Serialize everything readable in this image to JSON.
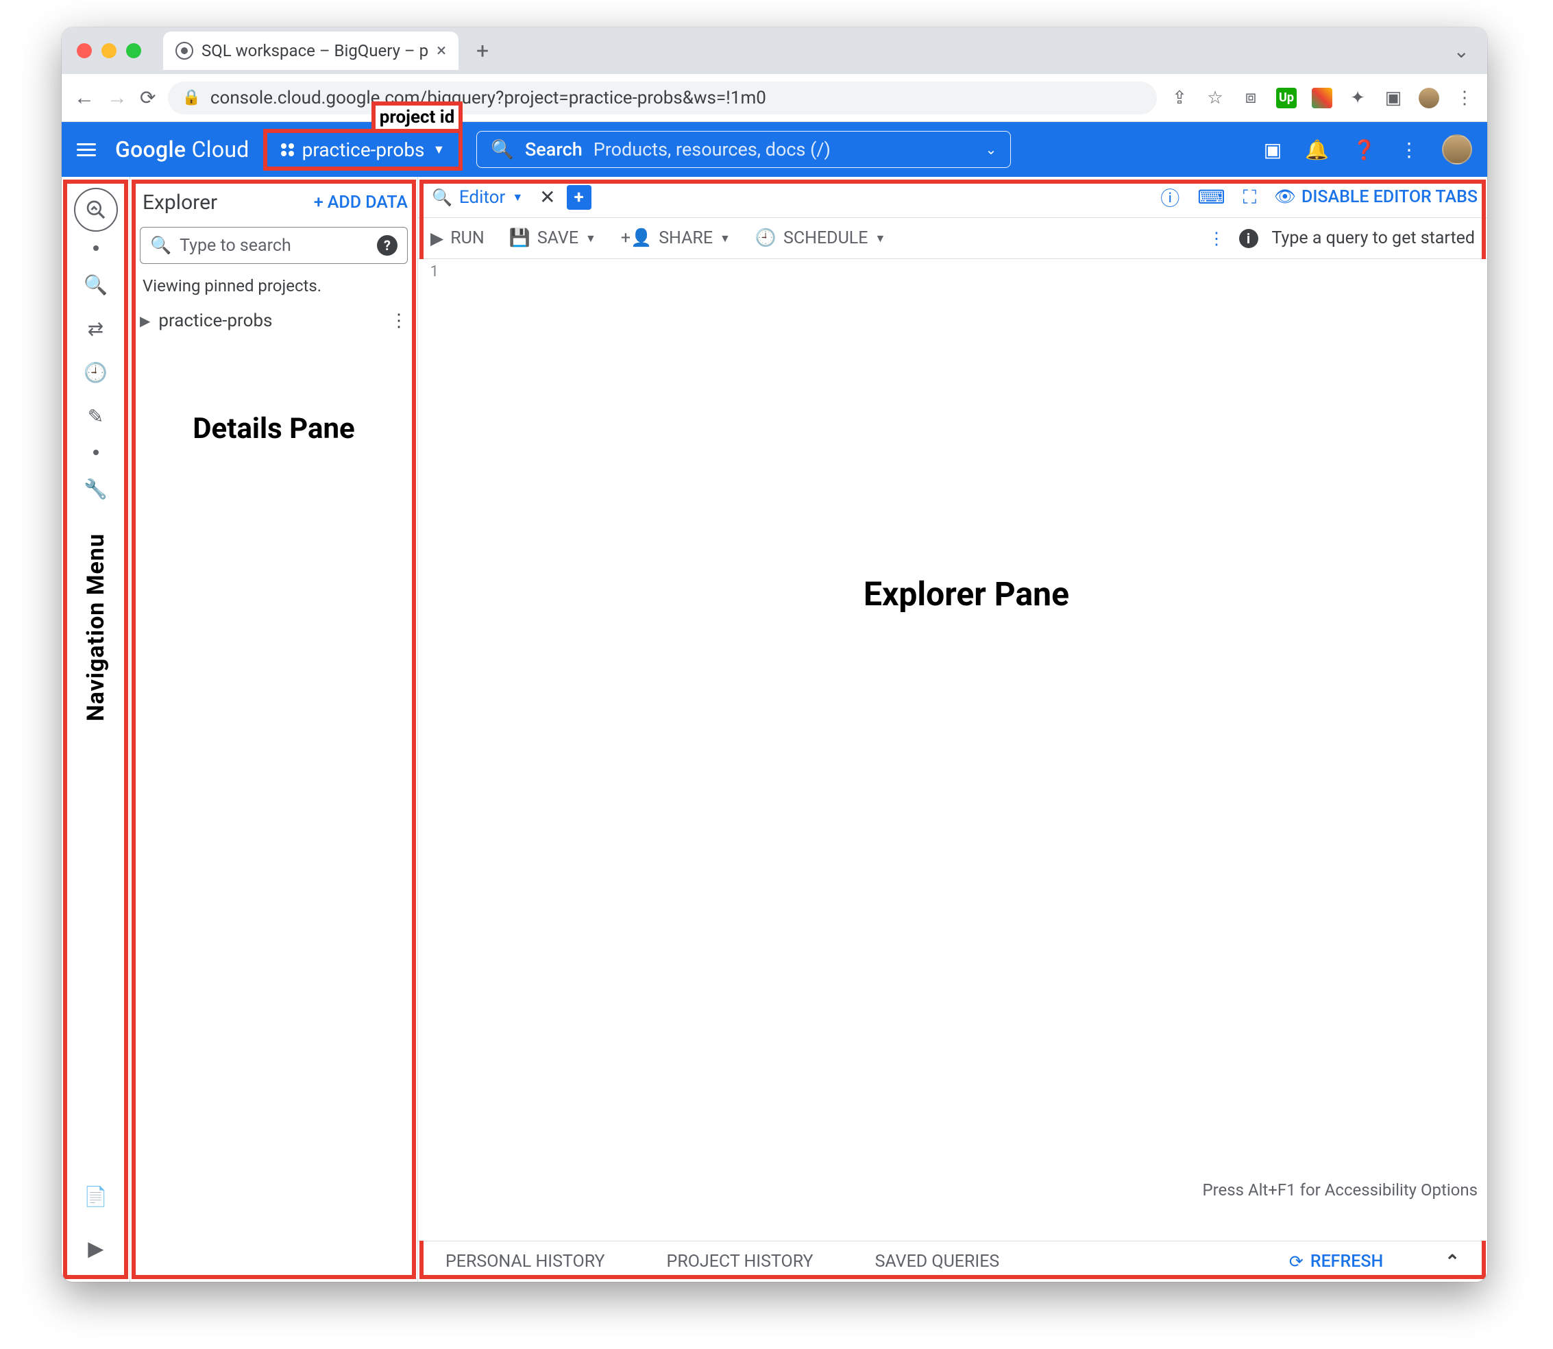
{
  "browser": {
    "tab_title": "SQL workspace – BigQuery – p",
    "url": "console.cloud.google.com/bigquery?project=practice-probs&ws=!1m0"
  },
  "cloud_header": {
    "logo_a": "Google",
    "logo_b": "Cloud",
    "project_id": "practice-probs",
    "project_label": "project id",
    "search_label": "Search",
    "search_placeholder": "Products, resources, docs (/)"
  },
  "nav_menu_label": "Navigation Menu",
  "explorer": {
    "title": "Explorer",
    "add_data": "ADD DATA",
    "search_placeholder": "Type to search",
    "viewing_note": "Viewing pinned projects.",
    "project_name": "practice-probs",
    "annotation": "Details Pane"
  },
  "editor": {
    "tab_label": "Editor",
    "disable_tabs": "DISABLE EDITOR TABS",
    "toolbar": {
      "run": "RUN",
      "save": "SAVE",
      "share": "SHARE",
      "schedule": "SCHEDULE",
      "hint": "Type a query to get started"
    },
    "line_no": "1",
    "annotation": "Explorer Pane",
    "accessibility_hint": "Press Alt+F1 for Accessibility Options",
    "bottom": {
      "personal": "PERSONAL HISTORY",
      "project": "PROJECT HISTORY",
      "saved": "SAVED QUERIES",
      "refresh": "REFRESH"
    }
  }
}
